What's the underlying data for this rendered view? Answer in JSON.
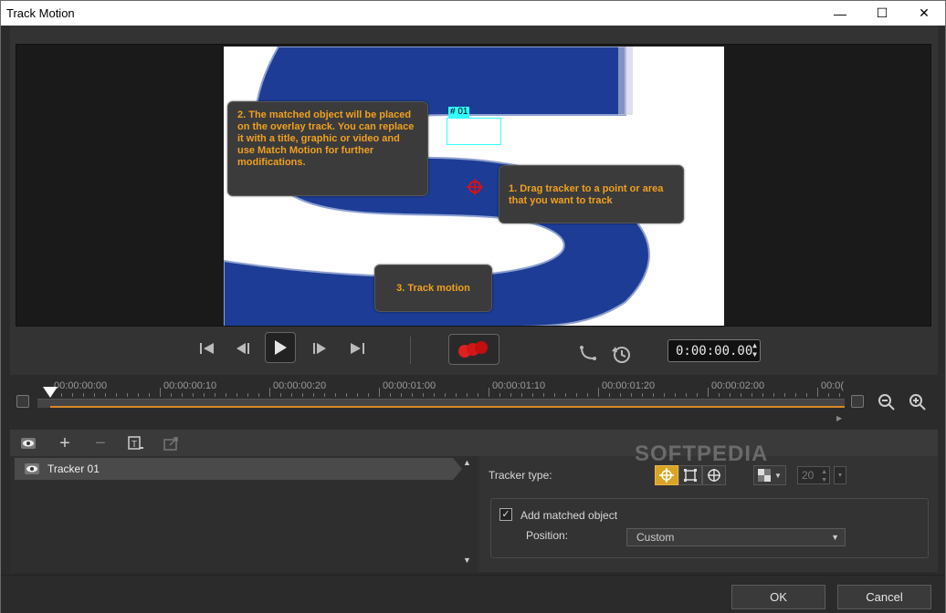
{
  "window": {
    "title": "Track Motion",
    "minimize_glyph": "—",
    "maximize_glyph": "☐",
    "close_glyph": "✕"
  },
  "preview": {
    "callout_match": "2. The matched object will be placed on the overlay track. You can replace it with a title, graphic or video and use Match Motion for further modifications.",
    "callout_drag": "1. Drag tracker to a point or area that you want to track",
    "callout_track": "3. Track motion",
    "tracker_label": "# 01"
  },
  "playback": {
    "timecode": "0:00:00.00"
  },
  "timeline": {
    "labels": [
      "00:00:00:00",
      "00:00:00:10",
      "00:00:00:20",
      "00:00:01:00",
      "00:00:01:10",
      "00:00:01:20",
      "00:00:02:00",
      "00:0("
    ],
    "progress": 0.0
  },
  "tracker_list": {
    "items": [
      {
        "label": "Tracker 01"
      }
    ]
  },
  "properties": {
    "tracker_type_label": "Tracker type:",
    "size_value": "20",
    "add_matched_label": "Add matched object",
    "add_matched_checked": true,
    "position_label": "Position:",
    "position_value": "Custom"
  },
  "footer": {
    "ok_label": "OK",
    "cancel_label": "Cancel"
  },
  "watermark": "SOFTPEDIA",
  "colors": {
    "accent": "#d9a425",
    "callout_text": "#f0a020",
    "timeline_bar": "#d88a22",
    "logo_blue": "#1c3c96"
  }
}
